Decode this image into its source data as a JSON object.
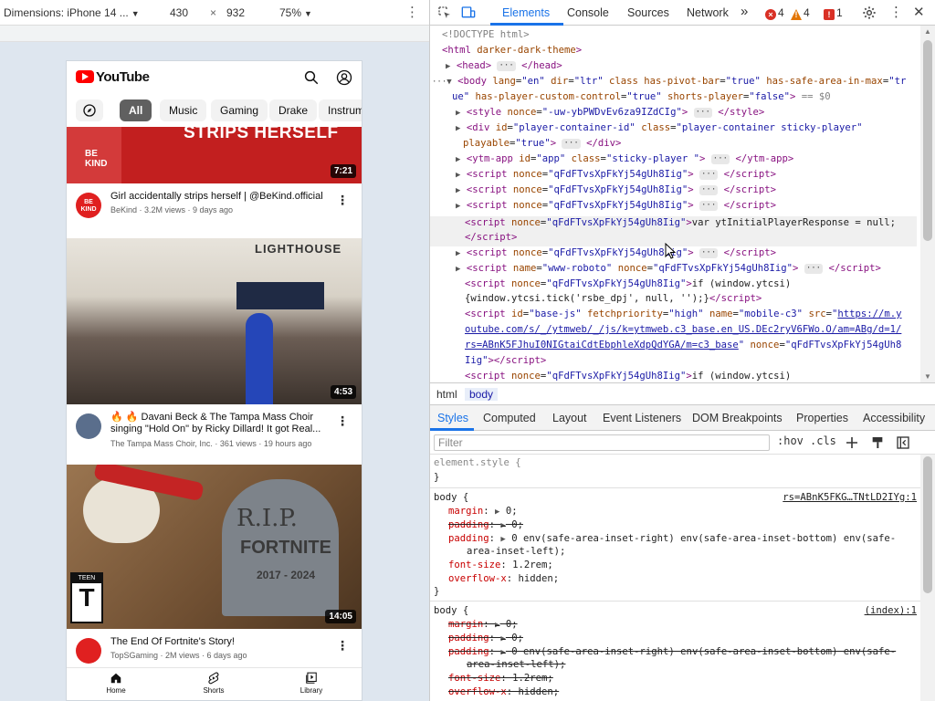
{
  "device_toolbar": {
    "dimensions_label": "Dimensions: iPhone 14 ...",
    "width": "430",
    "times": "×",
    "height": "932",
    "zoom": "75%"
  },
  "youtube": {
    "brand": "YouTube",
    "chips": [
      "All",
      "Music",
      "Gaming",
      "Drake",
      "Instrum"
    ],
    "videos": [
      {
        "banner_text": "STRIPS HERSELF",
        "duration": "7:21",
        "title": "Girl accidentally strips herself | @BeKind.official",
        "channel_line": "BeKind · 3.2M views · 9 days ago",
        "avatar_text": "BE KIND"
      },
      {
        "duration": "4:53",
        "title": "🔥 🔥 Davani Beck & The Tampa Mass Choir singing \"Hold On\" by Ricky Dillard! It got Real...",
        "channel_line": "The Tampa Mass Choir, Inc. · 361 views · 19 hours ago",
        "banner_text": "LIGHTHOUSE"
      },
      {
        "duration": "14:05",
        "title": "The End Of Fortnite's Story!",
        "channel_line": "TopSGaming · 2M views · 6 days ago",
        "rip_text": "R.I.P.",
        "fortnite_text": "FORTNITE",
        "years_text": "2017 - 2024",
        "rating_text": "T"
      }
    ],
    "nav": [
      "Home",
      "Shorts",
      "Library"
    ]
  },
  "devtools": {
    "tabs": [
      "Elements",
      "Console",
      "Sources",
      "Network"
    ],
    "more": "»",
    "errors": "4",
    "warnings": "4",
    "issues": "1",
    "crumbs": [
      "html",
      "body"
    ],
    "style_tabs": [
      "Styles",
      "Computed",
      "Layout",
      "Event Listeners",
      "DOM Breakpoints",
      "Properties",
      "Accessibility"
    ],
    "filter_placeholder": "Filter",
    "hov": ":hov",
    "cls": ".cls",
    "colors": {
      "accent": "#1a73e8",
      "error": "#d93025",
      "warning": "#e37400"
    }
  }
}
